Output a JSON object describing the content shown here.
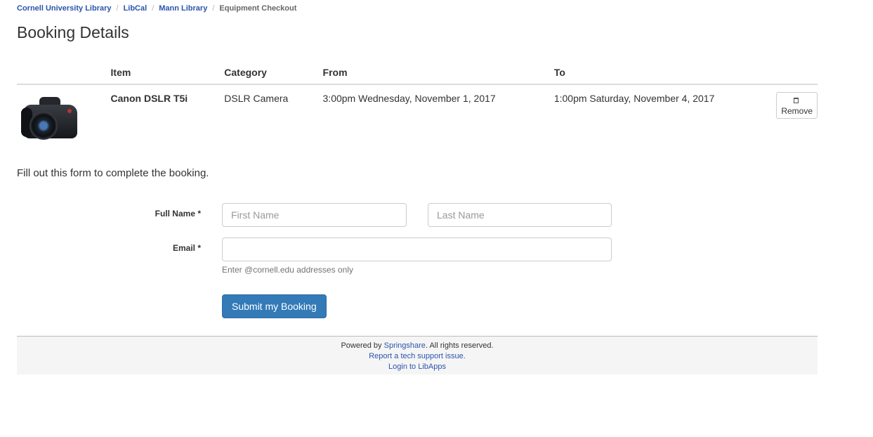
{
  "breadcrumb": {
    "items": [
      "Cornell University Library",
      "LibCal",
      "Mann Library"
    ],
    "current": "Equipment Checkout",
    "separator": "/"
  },
  "page_title": "Booking Details",
  "table": {
    "headers": {
      "item": "Item",
      "category": "Category",
      "from": "From",
      "to": "To"
    },
    "row": {
      "image_icon": "camera-image",
      "item": "Canon DSLR T5i",
      "category": "DSLR Camera",
      "from": "3:00pm Wednesday, November 1, 2017",
      "to": "1:00pm Saturday, November 4, 2017",
      "remove_label": "Remove",
      "remove_icon": "trash-icon"
    }
  },
  "instructions": "Fill out this form to complete the booking.",
  "form": {
    "full_name_label": "Full Name *",
    "first_name_placeholder": "First Name",
    "last_name_placeholder": "Last Name",
    "email_label": "Email *",
    "email_value": "",
    "email_help": "Enter @cornell.edu addresses only",
    "submit_label": "Submit my Booking"
  },
  "footer": {
    "powered_prefix": "Powered by ",
    "powered_link": "Springshare",
    "powered_suffix": ". All rights reserved.",
    "support_link": "Report a tech support issue.",
    "login_link": "Login to LibApps"
  },
  "colors": {
    "link": "#2a54ad",
    "primary_button": "#337ab7",
    "footer_bg": "#f5f5f5"
  }
}
